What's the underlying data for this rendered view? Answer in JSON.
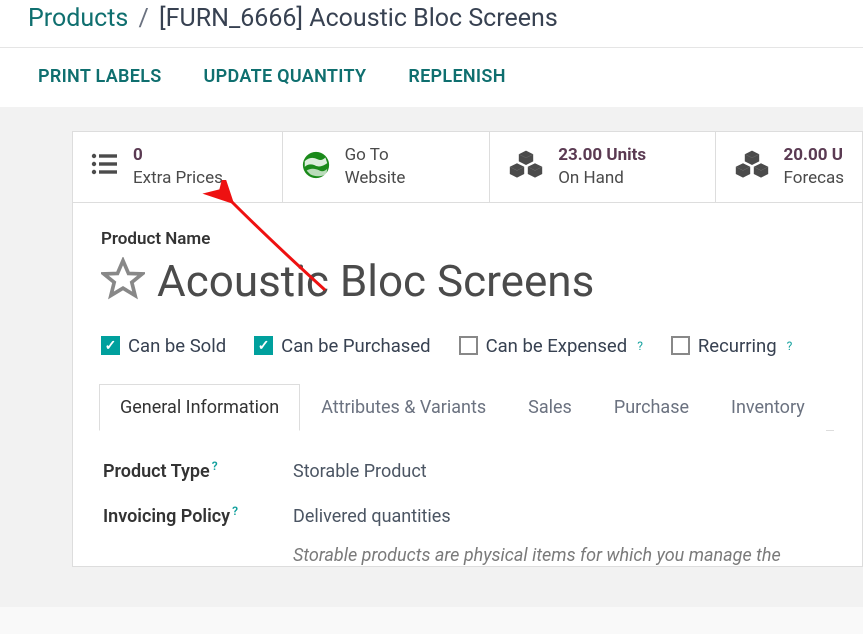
{
  "breadcrumb": {
    "root": "Products",
    "sep": "/",
    "current": "[FURN_6666] Acoustic Bloc Screens"
  },
  "actions": {
    "print_labels": "PRINT LABELS",
    "update_quantity": "UPDATE QUANTITY",
    "replenish": "REPLENISH"
  },
  "stats": {
    "extra_prices": {
      "count": "0",
      "label": "Extra Prices"
    },
    "website": {
      "line1": "Go To",
      "line2": "Website"
    },
    "on_hand": {
      "value": "23.00 Units",
      "label": "On Hand"
    },
    "forecast": {
      "value": "20.00 U",
      "label": "Forecas"
    }
  },
  "product": {
    "name_label": "Product Name",
    "name": "Acoustic Bloc Screens"
  },
  "flags": {
    "can_be_sold": "Can be Sold",
    "can_be_purchased": "Can be Purchased",
    "can_be_expensed": "Can be Expensed",
    "recurring": "Recurring"
  },
  "tabs": {
    "general": "General Information",
    "attributes": "Attributes & Variants",
    "sales": "Sales",
    "purchase": "Purchase",
    "inventory": "Inventory"
  },
  "general": {
    "product_type_label": "Product Type",
    "product_type_value": "Storable Product",
    "invoicing_policy_label": "Invoicing Policy",
    "invoicing_policy_value": "Delivered quantities",
    "footnote": "Storable products are physical items for which you manage the"
  }
}
